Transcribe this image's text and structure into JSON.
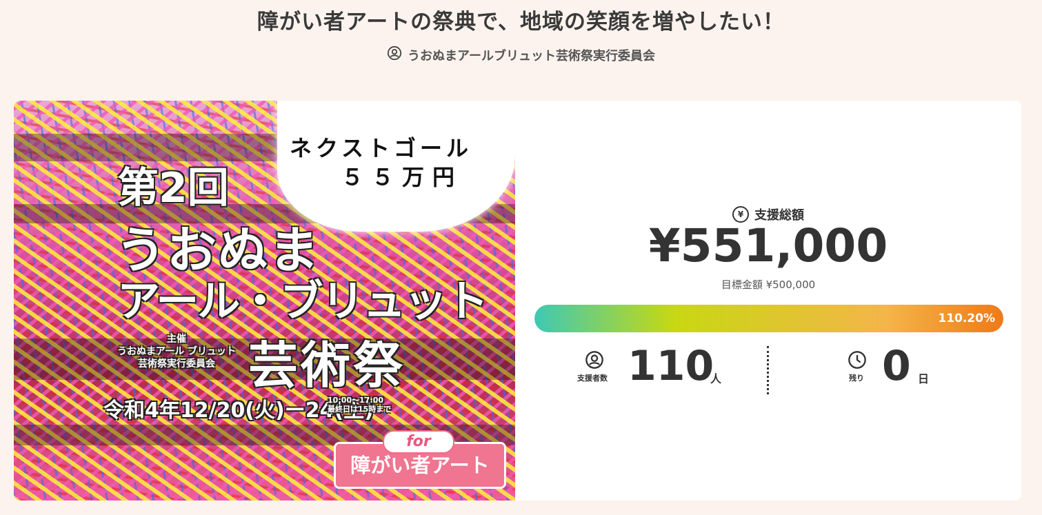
{
  "project": {
    "title": "障がい者アートの祭典で、地域の笑顔を増やしたい！",
    "owner": "うおぬまアールブリュット芸術祭実行委員会"
  },
  "hero": {
    "cloud_line1": "ネクストゴール",
    "cloud_line2": "５５万円",
    "edition": "第2回",
    "name_line1": "うおぬま",
    "name_line2": "アール・ブリュット",
    "name_line3": "芸術祭",
    "organizer": "主催\nうおぬまアール ブリュット\n芸術祭実行委員会",
    "dates": "令和4年12/20(火)ー24(土)",
    "hours": "10:00〜17:00\n最終日は15時まで",
    "badge_for": "for",
    "badge_label": "障がい者アート"
  },
  "stats": {
    "total_label": "支援総額",
    "total_amount": "¥551,000",
    "target_label": "目標金額 ¥500,000",
    "progress_percent": 110.2,
    "progress_text": "110.20%",
    "supporters_label": "支援者数",
    "supporters_count": "110",
    "supporters_unit": "人",
    "remaining_label": "残り",
    "remaining_count": "0",
    "remaining_unit": "日"
  },
  "colors": {
    "background": "#fcf3ee",
    "progress_start": "#3ec9b4",
    "progress_end": "#ef7a17",
    "badge_pink": "#ef7590"
  },
  "icons": {
    "owner": "person-circle-icon",
    "total": "yen-icon",
    "supporters": "person-circle-icon",
    "remaining": "clock-icon"
  }
}
